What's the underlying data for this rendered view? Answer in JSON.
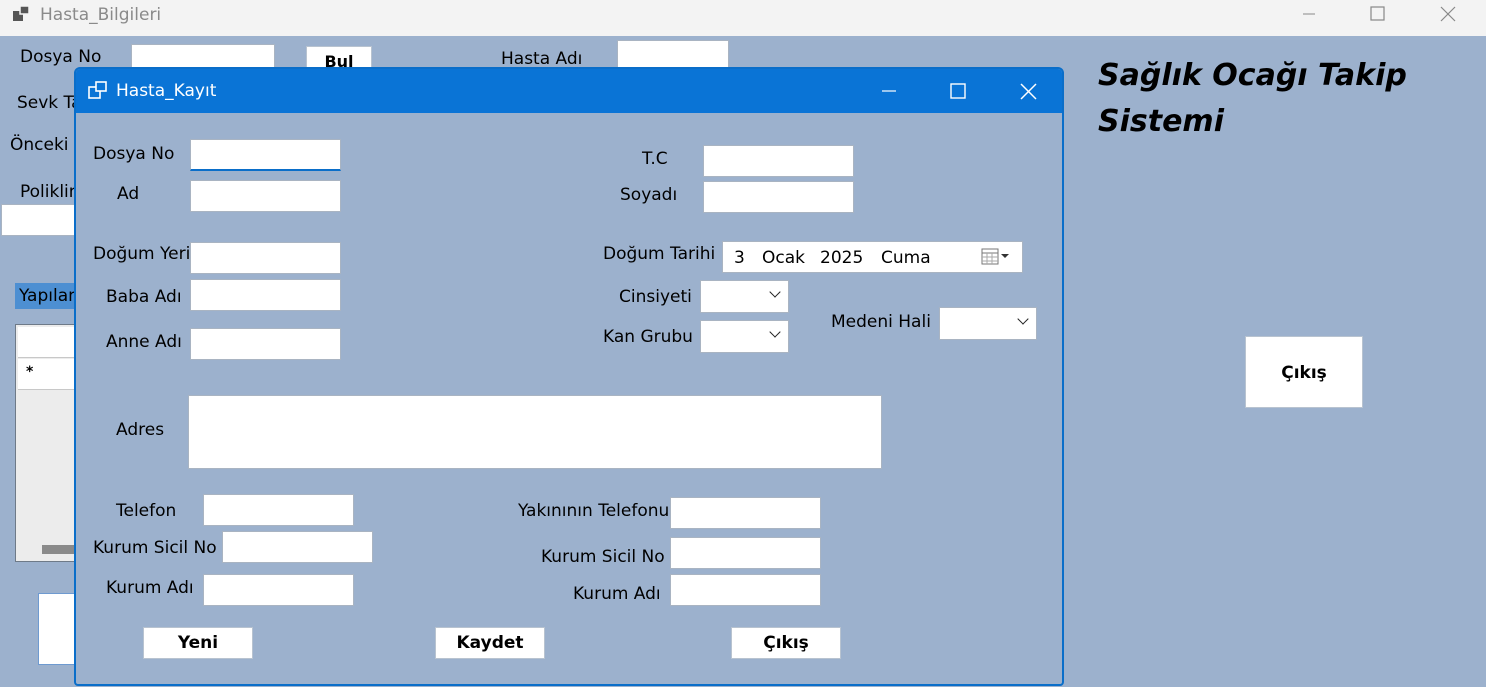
{
  "background_window": {
    "title": "Hasta_Bilgileri",
    "labels": {
      "dosya_no": "Dosya No",
      "hasta_adi": "Hasta Adı",
      "sevk": "Sevk Ta",
      "onceki": "Önceki İ",
      "poliklinik": "Poliklin",
      "yapilan": "Yapılan"
    },
    "buttons": {
      "bul": "Bul",
      "cikis": "Çıkış"
    },
    "heading": "Sağlık Ocağı Takip Sistemi",
    "grid_row_marker": "*"
  },
  "dialog": {
    "title": "Hasta_Kayıt",
    "labels": {
      "dosya_no": "Dosya No",
      "ad": "Ad",
      "tc": "T.C",
      "soyadi": "Soyadı",
      "dogum_yeri": "Doğum Yeri",
      "baba_adi": "Baba Adı",
      "anne_adi": "Anne Adı",
      "dogum_tarihi": "Doğum Tarihi",
      "cinsiyeti": "Cinsiyeti",
      "kan_grubu": "Kan Grubu",
      "medeni_hali": "Medeni Hali",
      "adres": "Adres",
      "telefon": "Telefon",
      "kurum_sicil_no_left": "Kurum Sicil No",
      "kurum_adi_left": "Kurum Adı",
      "yakinin_telefonu": "Yakınının Telefonu",
      "kurum_sicil_no_right": "Kurum Sicil No",
      "kurum_adi_right": "Kurum Adı"
    },
    "date_picker": {
      "day": "3",
      "month": "Ocak",
      "year": "2025",
      "weekday": "Cuma"
    },
    "buttons": {
      "yeni": "Yeni",
      "kaydet": "Kaydet",
      "cikis": "Çıkış"
    }
  },
  "colors": {
    "form_background": "#9cb1cd",
    "dialog_titlebar": "#0a74d6",
    "accent_border": "#0a6ec9"
  }
}
